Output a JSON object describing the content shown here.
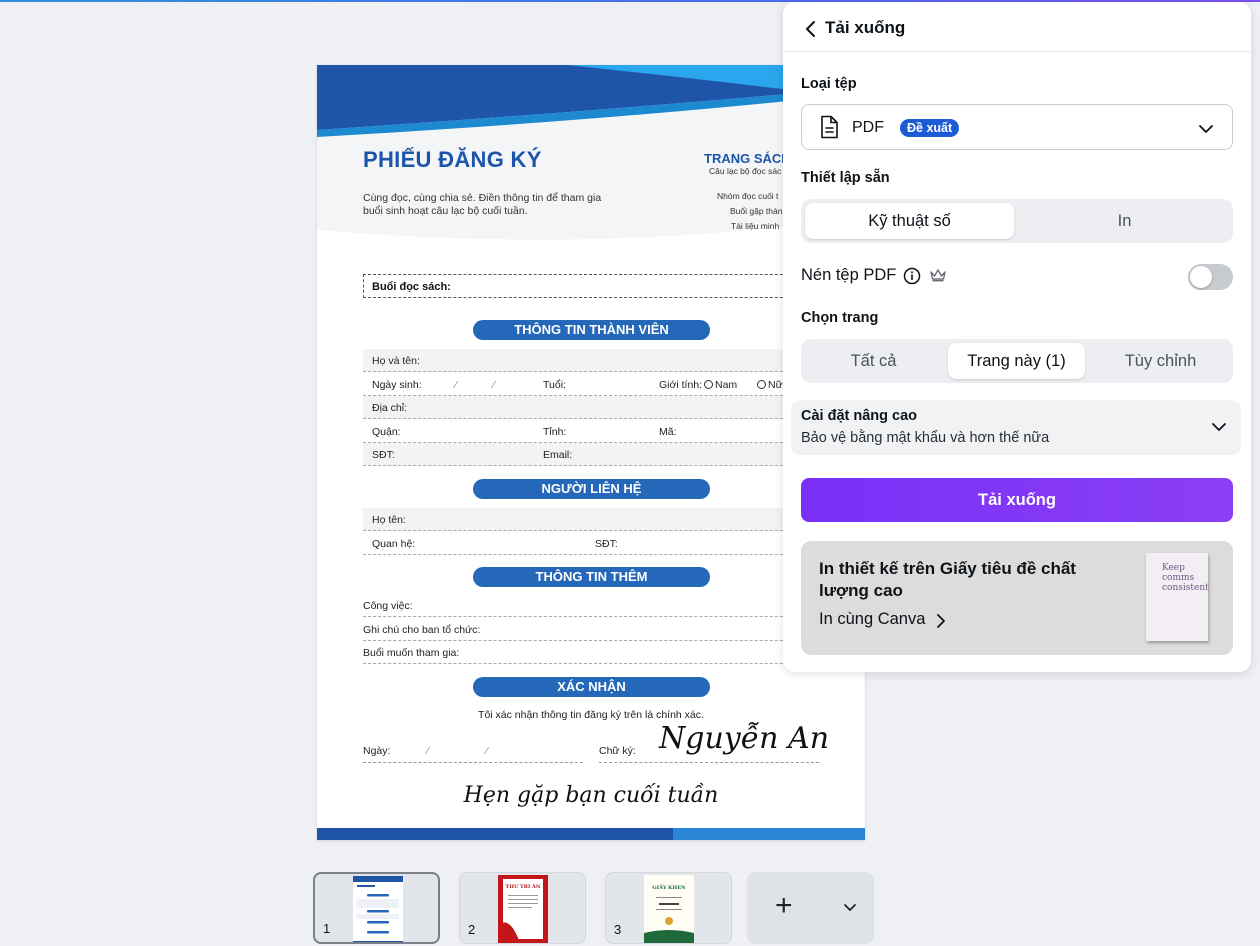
{
  "document": {
    "title": "PHIẾU ĐĂNG KÝ",
    "subtitle": "Cùng đọc, cùng chia sẻ. Điền thông tin để tham gia buổi sinh hoạt câu lạc bộ cuối tuần.",
    "brand": "TRANG SÁCH",
    "brand_sub": "Câu lạc bộ đọc sác",
    "meta": [
      "Nhóm đọc cuối t",
      "Buổi gặp thán",
      "Tài liệu minh"
    ],
    "session_label": "Buổi đọc sách:",
    "sections": {
      "member": "THÔNG TIN THÀNH VIÊN",
      "contact": "NGƯỜI LIÊN HỆ",
      "extra": "THÔNG TIN THÊM",
      "confirm": "XÁC NHẬN"
    },
    "fields": {
      "fullname": "Họ và tên:",
      "dob": "Ngày sinh:",
      "age": "Tuổi:",
      "gender": "Giới tính:",
      "male": "Nam",
      "female": "Nữ",
      "address": "Địa chỉ:",
      "district": "Quận:",
      "province": "Tỉnh:",
      "code": "Mã:",
      "phone": "SĐT:",
      "email": "Email:",
      "contact_name": "Họ tên:",
      "relation": "Quan hệ:",
      "contact_phone": "SĐT:",
      "job": "Công việc:",
      "note": "Ghi chú cho ban tổ chức:",
      "session_pref": "Buổi muốn tham gia:"
    },
    "confirm_text": "Tôi xác nhận thông tin đăng ký trên là chính xác.",
    "date_label": "Ngày:",
    "signature_label": "Chữ ký:",
    "signature_name": "Nguyễn An",
    "closing": "Hẹn gặp bạn cuối tuần"
  },
  "pages": [
    {
      "number": "1",
      "active": true
    },
    {
      "number": "2",
      "active": false
    },
    {
      "number": "3",
      "active": false
    }
  ],
  "mini_labels": {
    "p2": "THƯ TRI ÂN",
    "p3": "GIẤY KHEN"
  },
  "panel": {
    "title": "Tải xuống",
    "file_type_label": "Loại tệp",
    "file_type_value": "PDF",
    "file_type_badge": "Đề xuất",
    "preset_label": "Thiết lập sẵn",
    "preset_options": [
      "Kỹ thuật số",
      "In"
    ],
    "preset_selected": "Kỹ thuật số",
    "compress_label": "Nén tệp PDF",
    "compress_on": false,
    "pages_label": "Chọn trang",
    "page_options": [
      "Tất cả",
      "Trang này (1)",
      "Tùy chỉnh"
    ],
    "page_selected": "Trang này (1)",
    "advanced_title": "Cài đặt nâng cao",
    "advanced_desc": "Bảo vệ bằng mật khẩu và hơn thế nữa",
    "download_button": "Tải xuống",
    "promo_title": "In thiết kế trên Giấy tiêu đề chất lượng cao",
    "promo_link": "In cùng Canva",
    "promo_image_text": "Keep comms consistent"
  },
  "colors": {
    "accent_purple": "#7b2ff7",
    "badge_blue": "#1d5bd6",
    "doc_blue": "#1f55a8"
  }
}
